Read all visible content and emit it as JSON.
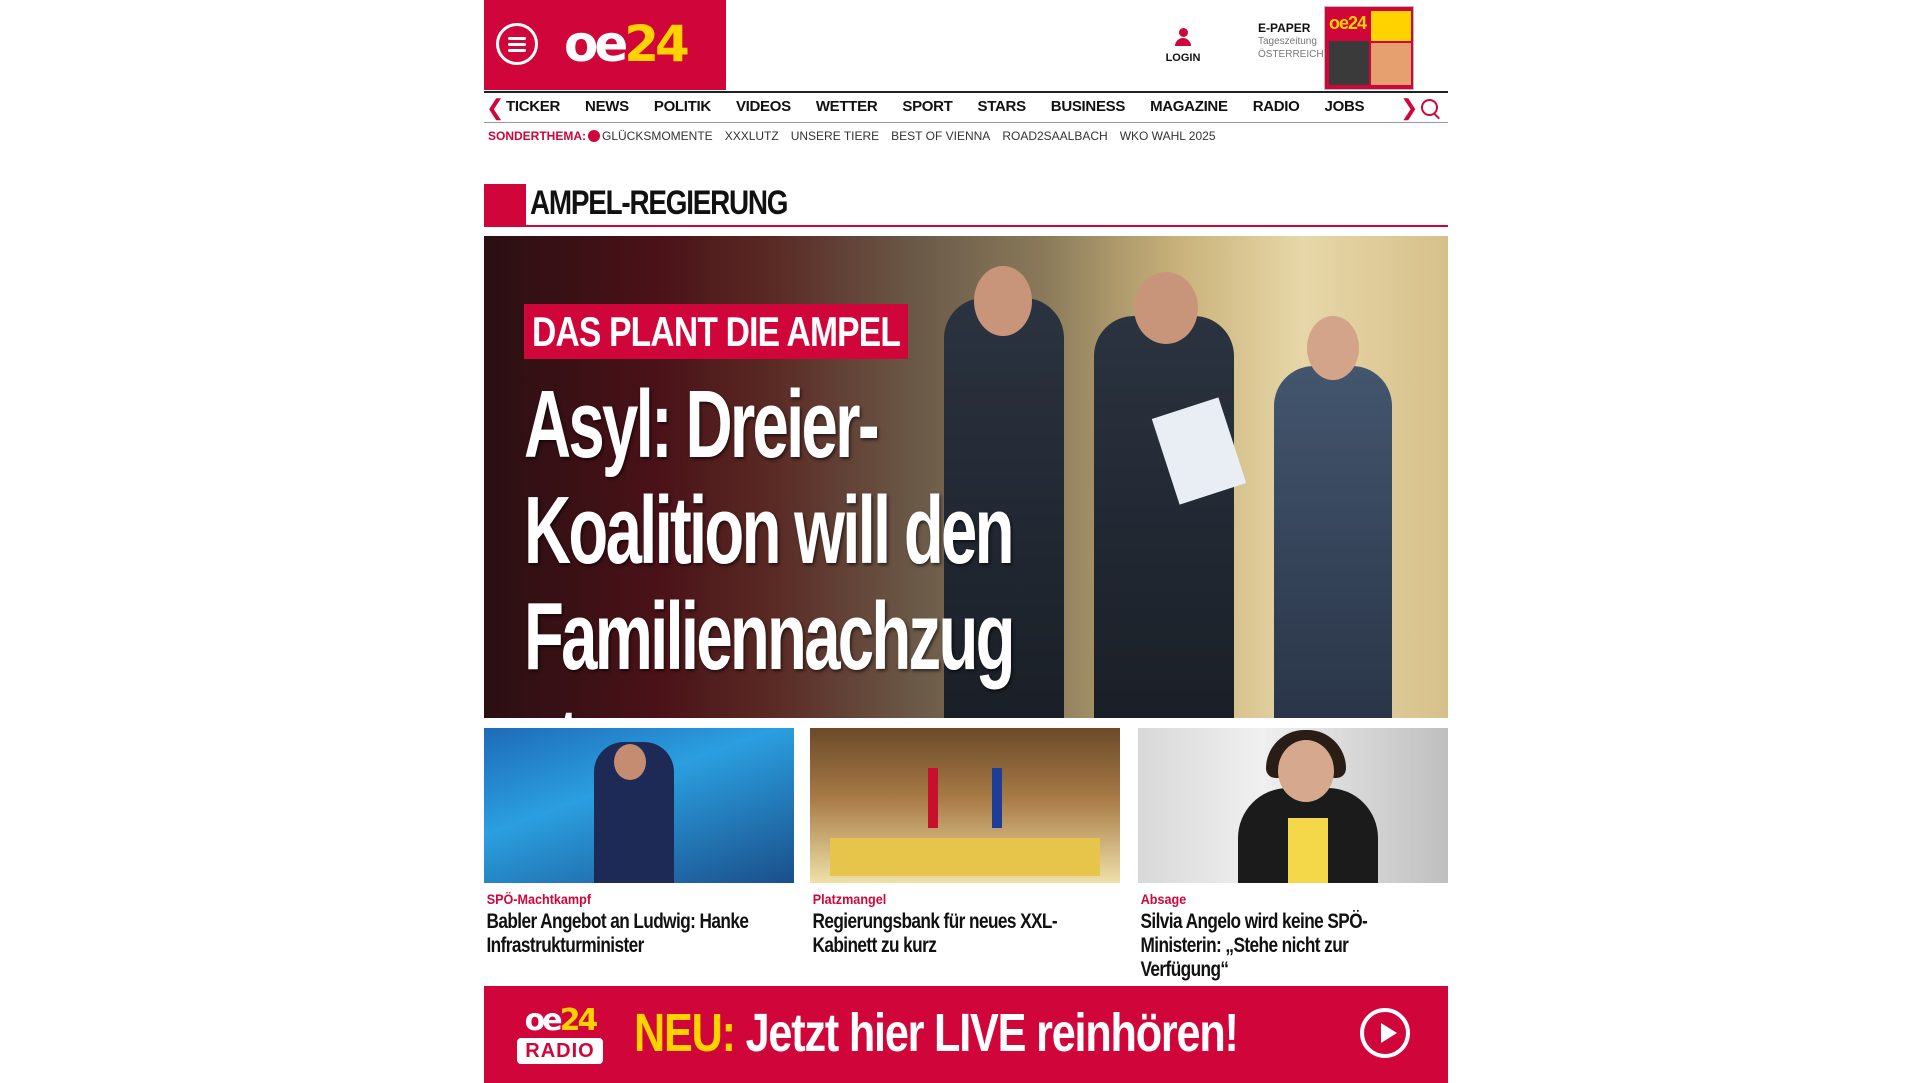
{
  "header": {
    "logo_main": "oe",
    "logo_num": "24",
    "login_label": "LOGIN",
    "epaper": {
      "title": "E-PAPER",
      "sub1": "Tageszeitung",
      "sub2": "ÖSTERREICH",
      "cover_logo": "oe24"
    }
  },
  "nav": {
    "items": [
      "TICKER",
      "NEWS",
      "POLITIK",
      "VIDEOS",
      "WETTER",
      "SPORT",
      "STARS",
      "BUSINESS",
      "MAGAZINE",
      "RADIO",
      "JOBS"
    ],
    "left_arrow": "❮",
    "right_arrow": "❯"
  },
  "subnav": {
    "label": "SONDERTHEMA:",
    "items": [
      "GLÜCKSMOMENTE",
      "XXXLUTZ",
      "UNSERE TIERE",
      "BEST OF VIENNA",
      "ROAD2SAALBACH",
      "WKO WAHL 2025"
    ]
  },
  "section": {
    "title": "AMPEL-REGIERUNG"
  },
  "hero": {
    "kicker": "DAS PLANT DIE AMPEL",
    "headline_lines": [
      "Asyl: Dreier-",
      "Koalition will den",
      "Familiennachzug stoppen"
    ]
  },
  "cards": [
    {
      "category": "SPÖ-Machtkampf",
      "title": "Babler Angebot an Ludwig: Hanke Infrastrukturminister"
    },
    {
      "category": "Platzmangel",
      "title": "Regierungsbank für neues XXL-Kabinett zu kurz"
    },
    {
      "category": "Absage",
      "title": "Silvia Angelo wird keine SPÖ-Ministerin: „Stehe nicht zur Verfügung“"
    }
  ],
  "radio": {
    "logo_main": "oe",
    "logo_num": "24",
    "logo_sub": "RADIO",
    "neu": "NEU:",
    "text": " Jetzt hier LIVE reinhören!"
  },
  "colors": {
    "brand_red": "#d0063a",
    "brand_yellow": "#ffd200"
  }
}
